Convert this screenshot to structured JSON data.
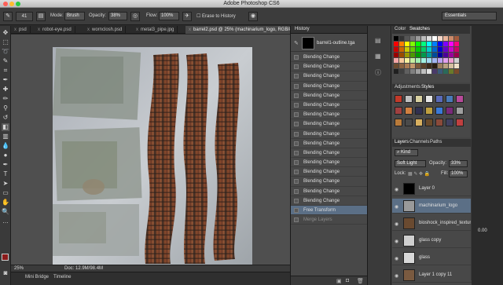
{
  "app": {
    "title": "Adobe Photoshop CS6",
    "workspace": "Essentials"
  },
  "colors": {
    "accent_selected": "#5b6f86",
    "foreground_swatch": "#8b1a1a",
    "background_swatch": "#ffffff"
  },
  "options": {
    "brush_size": "41",
    "mode_label": "Mode:",
    "mode_value": "Brush",
    "opacity_label": "Opacity:",
    "opacity_value": "38%",
    "flow_label": "Flow:",
    "flow_value": "100%",
    "erase_history": "Erase to History"
  },
  "tabs": [
    "psd",
    "robot-eye.psd",
    "wornclosh.psd",
    "metal3_pipe.jpg",
    "barrel2.psd @ 25% (machinarium_logo, RGB/8) *"
  ],
  "status": {
    "zoom": "25%",
    "doc": "Doc: 12.9M/98.4M"
  },
  "bottom_tabs": {
    "mini_bridge": "Mini Bridge",
    "timeline": "Timeline"
  },
  "history": {
    "panel_title": "History",
    "snapshot_name": "barrel1-outline.tga",
    "steps": [
      "Blending Change",
      "Blending Change",
      "Blending Change",
      "Blending Change",
      "Blending Change",
      "Blending Change",
      "Blending Change",
      "Blending Change",
      "Blending Change",
      "Blending Change",
      "Blending Change",
      "Blending Change",
      "Blending Change",
      "Blending Change",
      "Blending Change",
      "Blending Change",
      "Free Transform",
      "Merge Layers"
    ],
    "active_index": 16,
    "dimmed_index": 17
  },
  "color_panel": {
    "tab_color": "Color",
    "tab_swatches": "Swatches"
  },
  "adjust_panel": {
    "tab_adjustments": "Adjustments",
    "tab_styles": "Styles"
  },
  "layers_panel": {
    "tab_layers": "Layers",
    "tab_channels": "Channels",
    "tab_paths": "Paths",
    "kind": "Kind",
    "blend_mode": "Soft Light",
    "opacity_label": "Opacity:",
    "opacity_value": "33%",
    "lock_label": "Lock:",
    "fill_label": "Fill:",
    "fill_value": "100%",
    "layers": [
      {
        "name": "Layer 0",
        "selected": false
      },
      {
        "name": "machinarium_logo",
        "selected": true
      },
      {
        "name": "bioshock_inspired_texture_...",
        "selected": false
      },
      {
        "name": "glass copy",
        "selected": false
      },
      {
        "name": "glass",
        "selected": false
      },
      {
        "name": "Layer 1 copy 11",
        "selected": false
      }
    ]
  },
  "far_right": {
    "value": "0.00"
  }
}
